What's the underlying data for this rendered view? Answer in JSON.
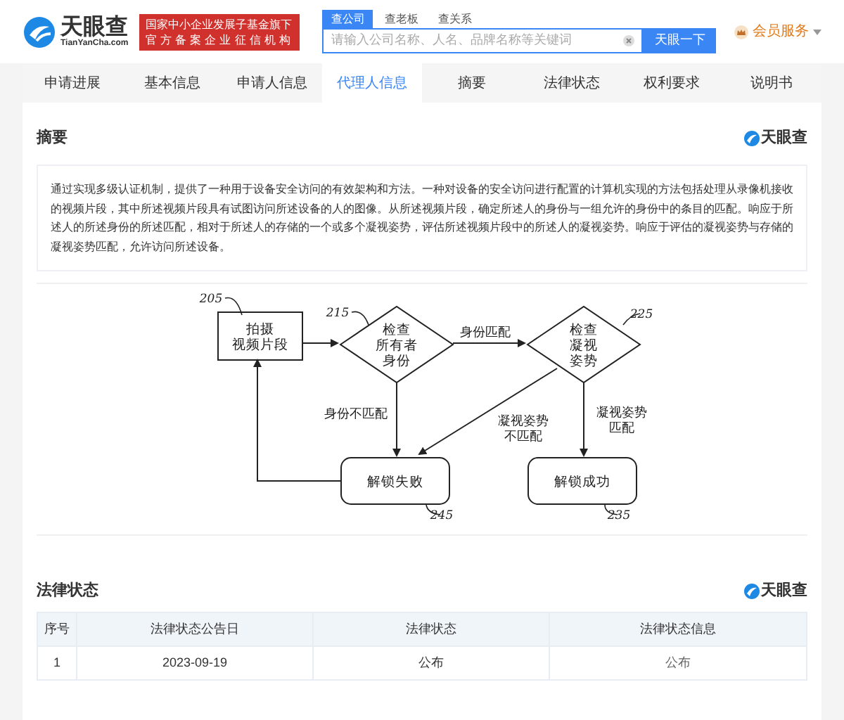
{
  "header": {
    "logo_text": "天眼查",
    "logo_domain": "TianYanCha.com",
    "badge_lines": [
      "国家中小企业发展子基金旗下",
      "官方备案企业征信机构"
    ],
    "search_tabs": [
      {
        "label": "查公司",
        "selected": true
      },
      {
        "label": "查老板",
        "selected": false
      },
      {
        "label": "查关系",
        "selected": false
      }
    ],
    "search": {
      "placeholder": "请输入公司名称、人名、品牌名称等关键词",
      "button": "天眼一下"
    },
    "member": "会员服务"
  },
  "tabs": [
    {
      "label": "申请进展",
      "selected": false
    },
    {
      "label": "基本信息",
      "selected": false
    },
    {
      "label": "申请人信息",
      "selected": false
    },
    {
      "label": "代理人信息",
      "selected": true
    },
    {
      "label": "摘要",
      "selected": false
    },
    {
      "label": "法律状态",
      "selected": false
    },
    {
      "label": "权利要求",
      "selected": false
    },
    {
      "label": "说明书",
      "selected": false
    }
  ],
  "abstract": {
    "title": "摘要",
    "brand": "天眼查",
    "text": "通过实现多级认证机制，提供了一种用于设备安全访问的有效架构和方法。一种对设备的安全访问进行配置的计算机实现的方法包括处理从录像机接收的视频片段，其中所述视频片段具有试图访问所述设备的人的图像。从所述视频片段，确定所述人的身份与一组允许的身份中的条目的匹配。响应于所述人的所述身份的所述匹配，相对于所述人的存储的一个或多个凝视姿势，评估所述视频片段中的所述人的凝视姿势。响应于评估的凝视姿势与存储的凝视姿势匹配，允许访问所述设备。"
  },
  "figure": {
    "nodes": [
      {
        "kind": "box",
        "ref": "205",
        "lines": [
          "拍摄",
          "视频片段"
        ]
      },
      {
        "kind": "diamond",
        "ref": "215",
        "lines": [
          "检查",
          "所有者",
          "身份"
        ]
      },
      {
        "kind": "diamond",
        "ref": "225",
        "lines": [
          "检查",
          "凝视",
          "姿势"
        ]
      },
      {
        "kind": "rounded",
        "ref": "245",
        "lines": [
          "解锁失败"
        ]
      },
      {
        "kind": "rounded",
        "ref": "235",
        "lines": [
          "解锁成功"
        ]
      }
    ],
    "edge_labels": [
      {
        "lines": [
          "身份匹配"
        ]
      },
      {
        "lines": [
          "身份不匹配"
        ]
      },
      {
        "lines": [
          "凝视姿势",
          "不匹配"
        ]
      },
      {
        "lines": [
          "凝视姿势",
          "匹配"
        ]
      }
    ]
  },
  "legal": {
    "title": "法律状态",
    "brand": "天眼查",
    "columns": [
      "序号",
      "法律状态公告日",
      "法律状态",
      "法律状态信息"
    ],
    "rows": [
      [
        "1",
        "2023-09-19",
        "公布",
        "公布"
      ]
    ]
  }
}
